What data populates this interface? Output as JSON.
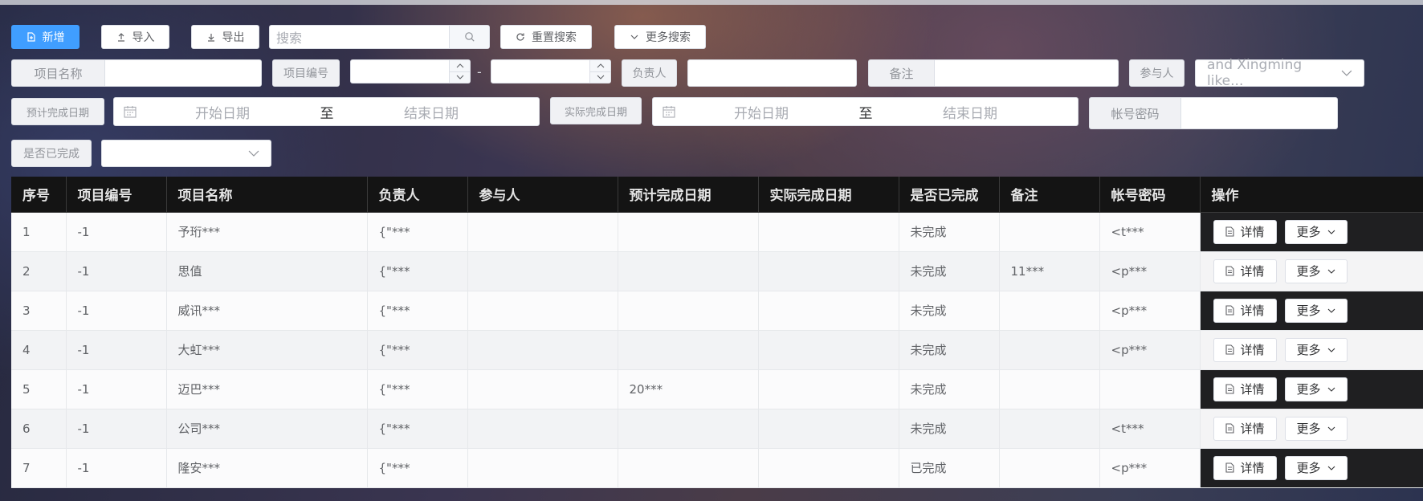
{
  "toolbar": {
    "add_label": "新增",
    "import_label": "导入",
    "export_label": "导出",
    "search_placeholder": "搜索",
    "reset_label": "重置搜索",
    "more_search_label": "更多搜索"
  },
  "filters": {
    "project_name_label": "项目名称",
    "project_no_label": "项目编号",
    "range_dash": "-",
    "owner_label": "负责人",
    "remark_label": "备注",
    "participant_label": "参与人",
    "participant_value": "and Xingming like...",
    "planned_date_label": "预计完成日期",
    "actual_date_label": "实际完成日期",
    "start_placeholder": "开始日期",
    "end_placeholder": "结束日期",
    "range_sep": "至",
    "account_label": "帐号密码",
    "completed_label": "是否已完成"
  },
  "table": {
    "columns": [
      "序号",
      "项目编号",
      "项目名称",
      "负责人",
      "参与人",
      "预计完成日期",
      "实际完成日期",
      "是否已完成",
      "备注",
      "帐号密码",
      "操作"
    ],
    "detail_label": "详情",
    "more_label": "更多",
    "rows": [
      {
        "no": "1",
        "code": "-1",
        "name": "予珩***",
        "owner": "{\"***",
        "participant": "",
        "planned": "",
        "actual": "",
        "done": "未完成",
        "done_flag": false,
        "remark": "",
        "account": "<t***"
      },
      {
        "no": "2",
        "code": "-1",
        "name": "思值",
        "owner": "{\"***",
        "participant": "",
        "planned": "",
        "actual": "",
        "done": "未完成",
        "done_flag": false,
        "remark": "11***",
        "account": "<p***"
      },
      {
        "no": "3",
        "code": "-1",
        "name": "威讯***",
        "owner": "{\"***",
        "participant": "",
        "planned": "",
        "actual": "",
        "done": "未完成",
        "done_flag": false,
        "remark": "",
        "account": "<p***"
      },
      {
        "no": "4",
        "code": "-1",
        "name": "大虹***",
        "owner": "{\"***",
        "participant": "",
        "planned": "",
        "actual": "",
        "done": "未完成",
        "done_flag": false,
        "remark": "",
        "account": "<p***"
      },
      {
        "no": "5",
        "code": "-1",
        "name": "迈巴***",
        "owner": "{\"***",
        "participant": "",
        "planned": "20***",
        "actual": "",
        "done": "未完成",
        "done_flag": false,
        "remark": "",
        "account": ""
      },
      {
        "no": "6",
        "code": "-1",
        "name": "公司***",
        "owner": "{\"***",
        "participant": "",
        "planned": "",
        "actual": "",
        "done": "未完成",
        "done_flag": false,
        "remark": "",
        "account": "<t***"
      },
      {
        "no": "7",
        "code": "-1",
        "name": "隆安***",
        "owner": "{\"***",
        "participant": "",
        "planned": "",
        "actual": "",
        "done": "已完成",
        "done_flag": true,
        "remark": "",
        "account": "<p***"
      }
    ]
  },
  "colors": {
    "primary": "#409eff",
    "danger": "#e02020",
    "header_bg": "#141414"
  }
}
